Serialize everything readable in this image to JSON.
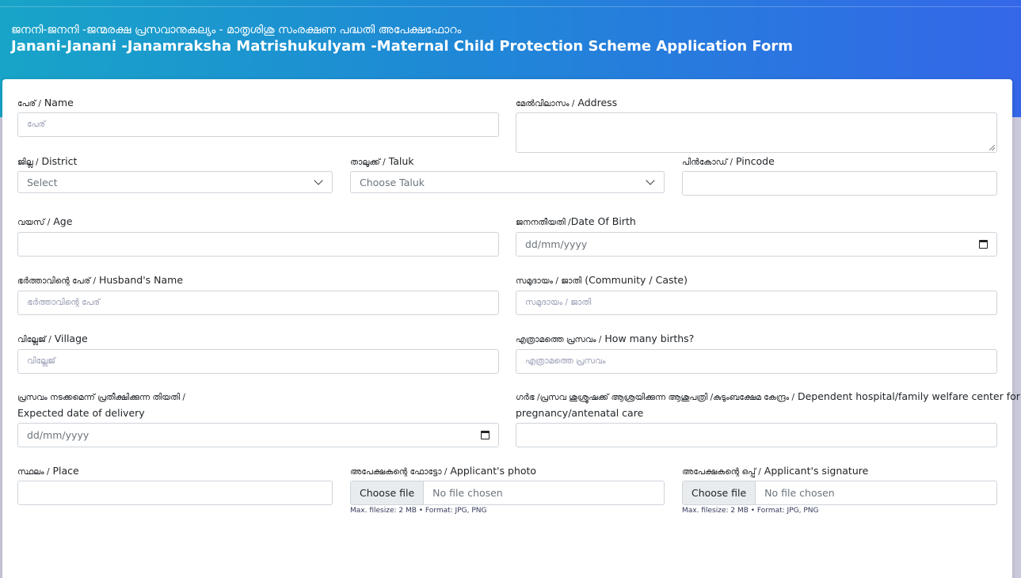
{
  "header": {
    "title_ml": "ജനനി-ജനനി -ജന്മരക്ഷ പ്രസവാനുകല്യം - മാതൃശിശു സംരക്ഷണ പദ്ധതി അപേക്ഷഫോറം",
    "title_en": "Janani-Janani -Janamraksha Matrishukulyam -Maternal Child Protection Scheme Application Form"
  },
  "form": {
    "name": {
      "label_ml": "പേര് /",
      "label_en": " Name",
      "placeholder": "പേര്",
      "value": ""
    },
    "address": {
      "label_ml": "മേൽവിലാസം /",
      "label_en": " Address",
      "value": ""
    },
    "district": {
      "label_ml": "ജില്ല /",
      "label_en": " District",
      "selected": "Select"
    },
    "taluk": {
      "label_ml": "താലൂക്ക് /",
      "label_en": " Taluk",
      "selected": "Choose Taluk"
    },
    "pincode": {
      "label_ml": "പിൻകോഡ് /",
      "label_en": " Pincode",
      "value": ""
    },
    "age": {
      "label_ml": "വയസ് /",
      "label_en": " Age",
      "value": ""
    },
    "dob": {
      "label_ml": "ജനനതീയതി /",
      "label_en": "Date Of Birth",
      "placeholder": "dd/mm/yyyy"
    },
    "husband": {
      "label_ml": "ഭർത്താവിന്റെ പേര് /",
      "label_en": " Husband's Name",
      "placeholder": "ഭർത്താവിന്റെ പേര്"
    },
    "community": {
      "label_ml": "സമുദായം / ജാതി",
      "label_en": " (Community / Caste)",
      "placeholder": "സമുദായം / ജാതി"
    },
    "village": {
      "label_ml": "വില്ലേജ് /",
      "label_en": " Village",
      "placeholder": "വില്ലേജ്"
    },
    "births": {
      "label_ml": "എത്രാമത്തെ പ്രസവം /",
      "label_en": " How many births?",
      "placeholder": "എത്രാമത്തെ പ്രസവം"
    },
    "delivery": {
      "label_ml": "പ്രസവം നടക്കമെന്ന് പ്രതീക്ഷിക്കുന്ന തിയതി /",
      "label_en": "Expected date of delivery",
      "placeholder": "dd/mm/yyyy"
    },
    "hospital": {
      "label_ml": "ഗർഭ /പ്രസവ ശുശ്രൂഷക്ക് ആശ്രയിക്കുന്ന ആശുപത്രി /കുടുംബക്ഷേമ കേന്ദ്രം /",
      "label_en": " Dependent hospital/family welfare center for",
      "label_en2": "pregnancy/antenatal care",
      "value": ""
    },
    "place": {
      "label_ml": "സ്ഥലം /",
      "label_en": " Place",
      "value": ""
    },
    "photo": {
      "label_ml": "അപേക്ഷകന്റെ ഫോട്ടോ /",
      "label_en": " Applicant's photo",
      "button": "Choose file",
      "status": "No file chosen",
      "hint": "Max. filesize: 2 MB • Format: JPG, PNG"
    },
    "signature": {
      "label_ml": "അപേക്ഷകന്റെ ഒപ്പ് /",
      "label_en": " Applicant's signature",
      "button": "Choose file",
      "status": "No file chosen",
      "hint": "Max. filesize: 2 MB • Format: JPG, PNG"
    }
  },
  "icons": {
    "select_arrow": "chevron-down-icon",
    "date": "calendar-icon"
  }
}
